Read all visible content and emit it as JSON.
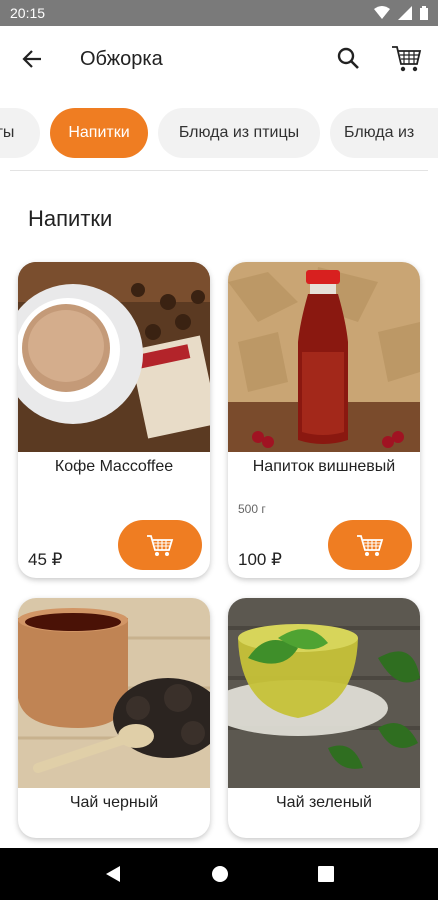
{
  "status": {
    "time": "20:15"
  },
  "header": {
    "title": "Обжорка"
  },
  "categories": [
    {
      "label": "ты"
    },
    {
      "label": "Напитки"
    },
    {
      "label": "Блюда из птицы"
    },
    {
      "label": "Блюда из"
    }
  ],
  "section": {
    "title": "Напитки"
  },
  "products": [
    {
      "name": "Кофе Maccoffee",
      "weight": "",
      "price": "45 ₽"
    },
    {
      "name": "Напиток вишневый",
      "weight": "500 г",
      "price": "100 ₽"
    },
    {
      "name": "Чай черный",
      "weight": "",
      "price": ""
    },
    {
      "name": "Чай зеленый",
      "weight": "",
      "price": ""
    }
  ],
  "colors": {
    "accent": "#ef7d22",
    "status_bar": "#7a7a7a"
  },
  "icons": [
    "back-arrow-icon",
    "search-icon",
    "cart-icon",
    "add-to-cart-icon"
  ]
}
